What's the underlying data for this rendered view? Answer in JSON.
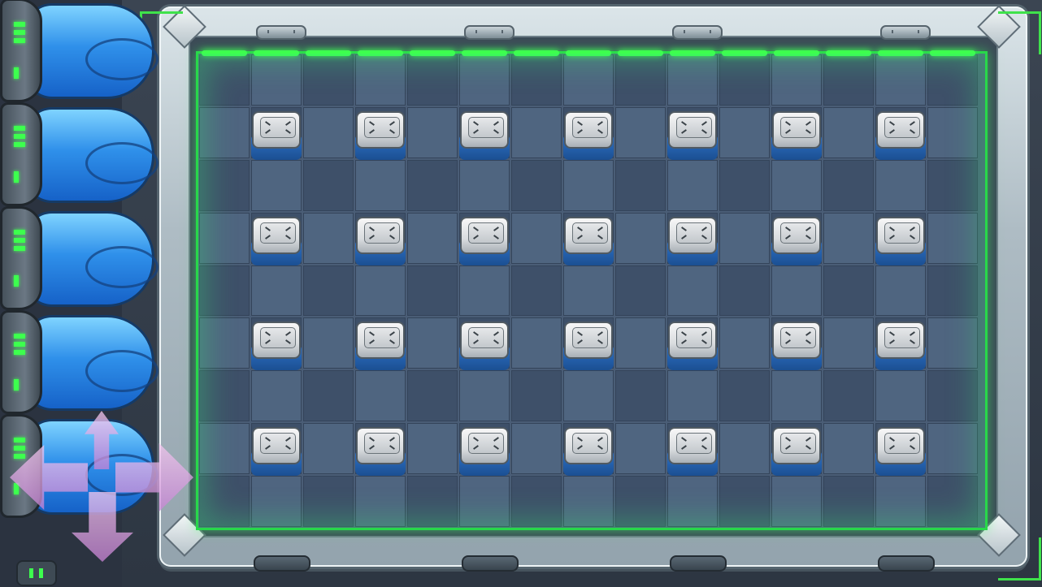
{
  "game": {
    "scene": "puzzle-board",
    "board": {
      "columns": 15,
      "rows": 9,
      "accent_color": "#3dff4e"
    },
    "blocks": {
      "columns": [
        1,
        3,
        5,
        7,
        9,
        11,
        13
      ],
      "rows": [
        1,
        3,
        5,
        7
      ],
      "icon": "block-face-icon"
    },
    "capsules": {
      "count": 5,
      "icon": "capsule-icon",
      "led_color": "#3dff4e"
    },
    "controls": {
      "dpad_icon": "dpad-arrows-icon",
      "pause_icon": "pause-icon"
    },
    "colors": {
      "tile_light": "#4f6580",
      "tile_dark": "#3e5069",
      "neon_green": "#3dff4e",
      "capsule_blue": "#2f90ea",
      "dpad_pink": "#d99ae0",
      "frame_metal": "#b9c7cd"
    }
  }
}
